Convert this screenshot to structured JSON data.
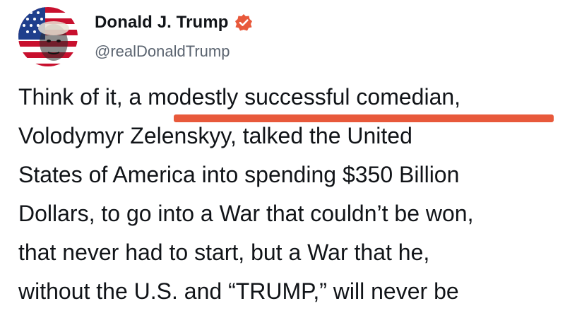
{
  "post": {
    "author": {
      "display_name": "Donald J. Trump",
      "handle": "@realDonaldTrump",
      "verified": true,
      "verified_color": "#e8593b",
      "avatar_icon": "avatar-flag-portrait"
    },
    "body_lines": [
      "Think of it, a modestly successful comedian,",
      "Volodymyr Zelenskyy, talked the United",
      "States of America into spending $350 Billion",
      "Dollars, to go into a War that couldn’t be won,",
      "that never had to start, but a War that he,",
      "without the U.S. and “TRUMP,” will never be"
    ],
    "highlight": {
      "color": "#e8593b"
    }
  }
}
